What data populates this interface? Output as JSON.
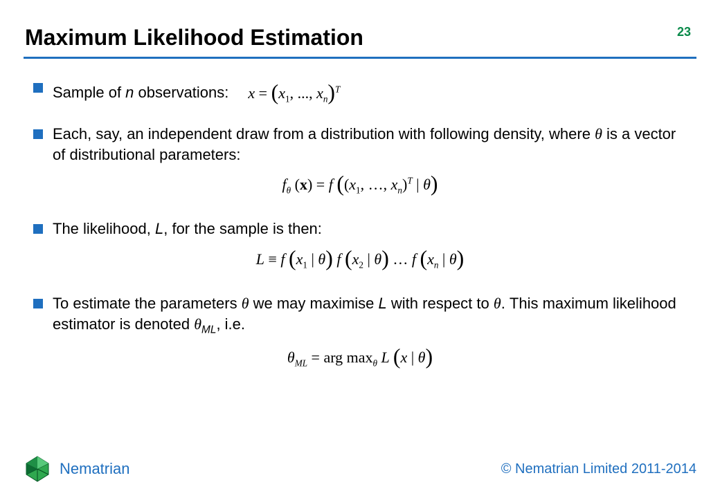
{
  "header": {
    "title": "Maximum Likelihood Estimation",
    "page_number": "23"
  },
  "bullets": {
    "b1": {
      "text_prefix": "Sample of ",
      "text_n": "n",
      "text_suffix": " observations:",
      "eq_x": "x",
      "eq_eq": " = ",
      "eq_l": "(",
      "eq_x1": "x",
      "eq_s1": "1",
      "eq_mid": ", ..., ",
      "eq_xn": "x",
      "eq_sn": "n",
      "eq_r": ")",
      "eq_T": "T"
    },
    "b2": {
      "text_a": "Each, say, an independent draw from a distribution with following density, where ",
      "theta": "θ",
      "text_b": " is a vector of distributional parameters:"
    },
    "eq2": {
      "f": "f",
      "theta_sub": "θ",
      "lp": " (",
      "x_bold": "x",
      "rp": ") ",
      "eq": "= ",
      "f2": "f",
      "bl": "(",
      "il": "(",
      "x1": "x",
      "s1": "1",
      "mid": ", …, ",
      "xn": "x",
      "sn": "n",
      "ir": ")",
      "T": "T",
      "bar": " | ",
      "theta": "θ",
      "br": ")"
    },
    "b3": {
      "text_a": "The likelihood, ",
      "L": "L",
      "text_b": ", for the sample is then:"
    },
    "eq3": {
      "L": "L",
      "equiv": " ≡ ",
      "f": "f",
      "l": "(",
      "x": "x",
      "s1": "1",
      "bar": " | ",
      "theta": "θ",
      "r": ")",
      "sp": " ",
      "s2": "2",
      "dots": " … ",
      "sn": "n"
    },
    "b4": {
      "text_a": "To estimate the parameters ",
      "theta": "θ",
      "text_b": "  we may maximise ",
      "L": "L",
      "text_c": " with respect to ",
      "theta2": "θ",
      "text_d": ". This maximum likelihood estimator is denoted ",
      "theta3": "θ",
      "ML": "ML",
      "text_e": ", i.e."
    },
    "eq4": {
      "theta": "θ",
      "ML": "ML",
      "eq": " = ",
      "arg": "arg max",
      "sub_theta": "θ",
      "sp": " ",
      "L": "L",
      "l": "(",
      "x": "x",
      "bar": " | ",
      "theta2": "θ",
      "r": ")"
    }
  },
  "footer": {
    "brand": "Nematrian",
    "copyright": "© Nematrian Limited 2011-2014"
  },
  "icons": {
    "logo": "nematrian-logo-icon"
  }
}
